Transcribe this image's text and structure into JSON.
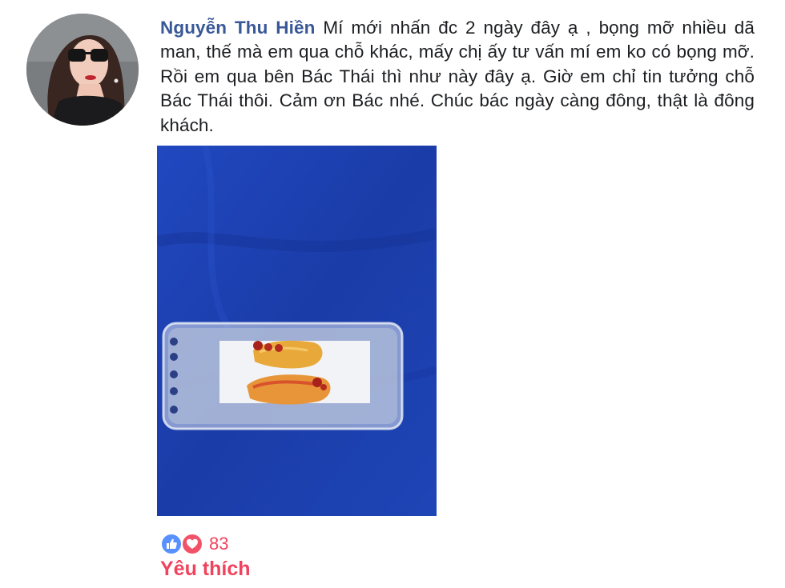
{
  "comment": {
    "author": "Nguyễn Thu Hiền",
    "text": "Mí mới nhấn đc 2 ngày đây ạ , bọng mỡ nhiều dã man, thế mà em qua chỗ khác, mấy chị ấy tư vấn mí em ko có bọng mỡ. Rồi em qua bên Bác Thái thì như này đây ạ. Giờ em chỉ tin tưởng chỗ Bác Thái thôi. Cảm ơn Bác nhé. Chúc bác ngày càng đông, thật là đông khách."
  },
  "reactions": {
    "icons": [
      "like-icon",
      "love-icon"
    ],
    "count": "83",
    "label": "Yêu thích"
  },
  "colors": {
    "author": "#385898",
    "text": "#1c1e21",
    "reaction_accent": "#f0435d",
    "like_blue": "#5890ff",
    "love_red": "#f25268"
  }
}
